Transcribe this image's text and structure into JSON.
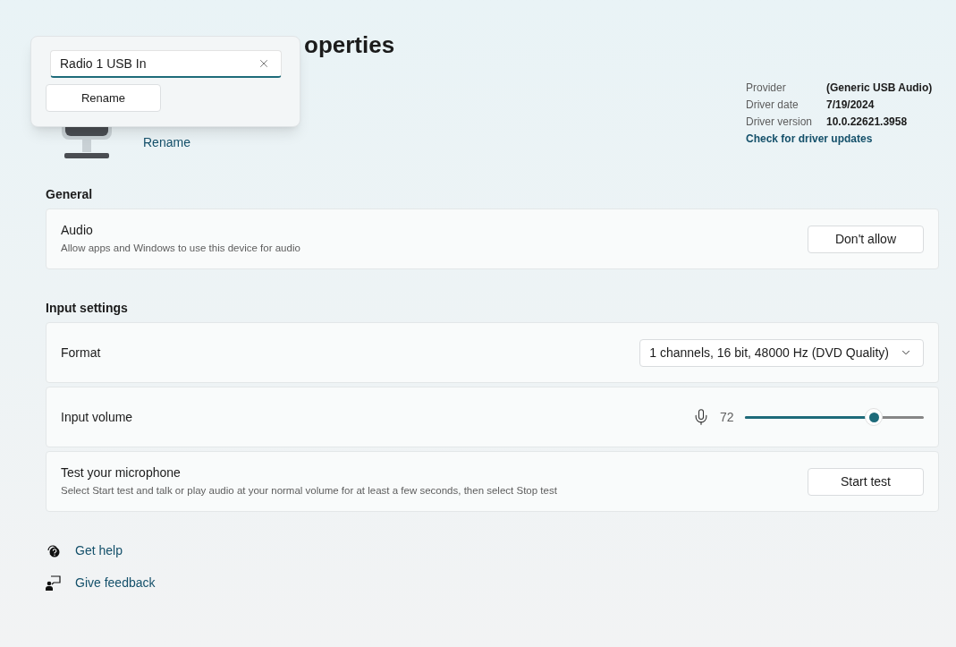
{
  "page": {
    "title_visible": "operties"
  },
  "rename_popup": {
    "field_value": "Radio 1 USB In",
    "button": "Rename"
  },
  "device": {
    "rename_link": "Rename"
  },
  "driver": [
    {
      "label": "Provider",
      "value": "(Generic USB Audio)"
    },
    {
      "label": "Driver date",
      "value": "7/19/2024"
    },
    {
      "label": "Driver version",
      "value": "10.0.22621.3958"
    }
  ],
  "driver_link": "Check for driver updates",
  "sections": [
    {
      "heading": "General",
      "cards": [
        {
          "kind": "button",
          "title": "Audio",
          "description": "Allow apps and Windows to use this device for audio",
          "button": "Don't allow"
        }
      ]
    },
    {
      "heading": "Input settings",
      "cards": [
        {
          "kind": "dropdown",
          "title": "Format",
          "value": "1 channels, 16 bit, 48000 Hz (DVD Quality)"
        },
        {
          "kind": "slider",
          "title": "Input volume",
          "reading": "72",
          "level": 0.72
        },
        {
          "kind": "button",
          "title": "Test your microphone",
          "description": "Select Start test and talk or play audio at your normal volume for at least a few seconds, then select Stop test",
          "button": "Start test"
        }
      ]
    }
  ],
  "links": [
    {
      "kind": "help",
      "label": "Get help"
    },
    {
      "kind": "feedback",
      "label": "Give feedback"
    }
  ]
}
